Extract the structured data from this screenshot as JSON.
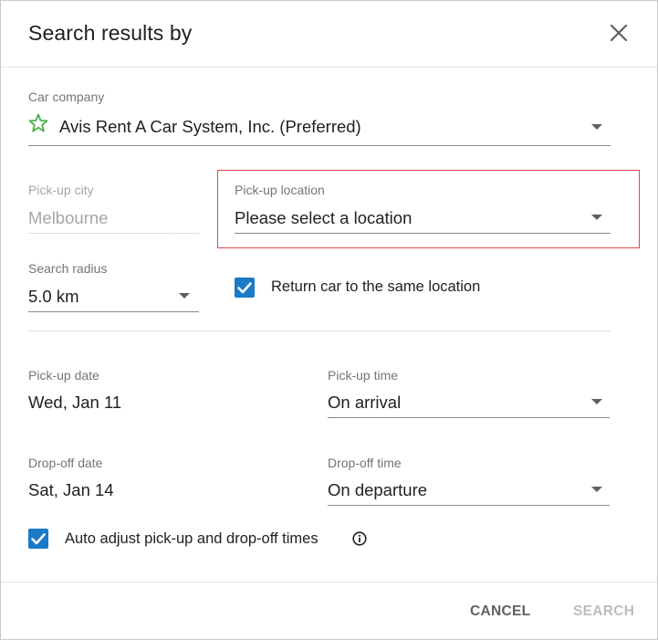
{
  "dialog": {
    "title": "Search results by",
    "close_icon": "close-icon"
  },
  "car_company": {
    "label": "Car company",
    "value": "Avis Rent A Car System, Inc. (Preferred)",
    "icon": "star-outline-icon",
    "icon_color": "#4caf50"
  },
  "pickup_city": {
    "label": "Pick-up city",
    "value": "Melbourne"
  },
  "pickup_location": {
    "label": "Pick-up location",
    "value": "Please select a location",
    "highlight_color": "#e0474c"
  },
  "search_radius": {
    "label": "Search radius",
    "value": "5.0 km"
  },
  "return_same_location": {
    "label": "Return car to the same location",
    "checked": true
  },
  "pickup_date": {
    "label": "Pick-up date",
    "value": "Wed, Jan 11"
  },
  "pickup_time": {
    "label": "Pick-up time",
    "value": "On arrival"
  },
  "dropoff_date": {
    "label": "Drop-off date",
    "value": "Sat, Jan 14"
  },
  "dropoff_time": {
    "label": "Drop-off time",
    "value": "On departure"
  },
  "auto_adjust": {
    "label": "Auto adjust pick-up and drop-off times",
    "checked": true,
    "info_icon": "info-icon"
  },
  "footer": {
    "cancel_label": "CANCEL",
    "search_label": "SEARCH"
  },
  "colors": {
    "checkbox": "#1a7ac7",
    "disabled_text": "#bdbdbd"
  }
}
